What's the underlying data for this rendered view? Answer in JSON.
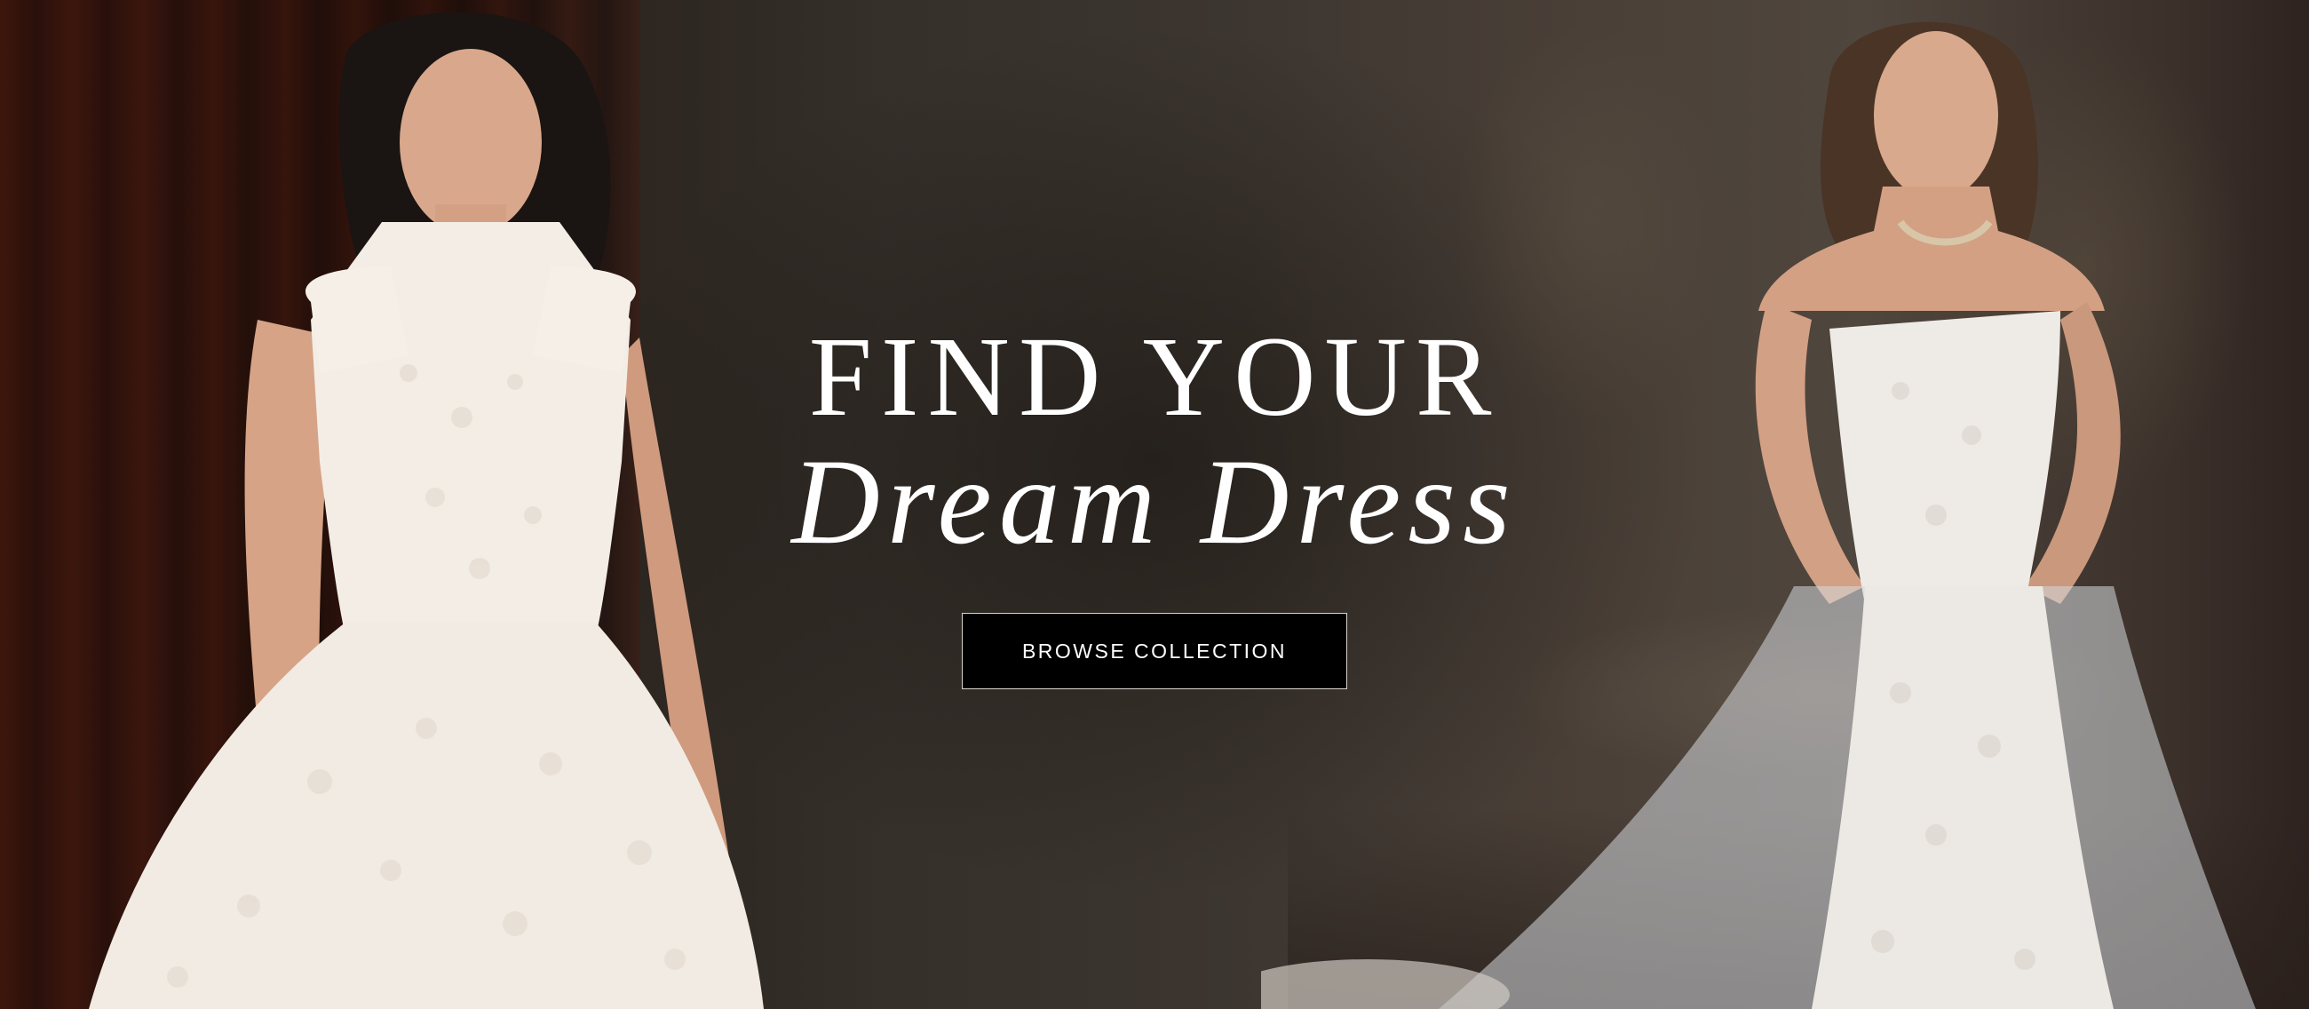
{
  "hero": {
    "headline_line1": "FIND YOUR",
    "headline_line2": "Dream Dress",
    "cta_label": "BROWSE COLLECTION"
  },
  "colors": {
    "text": "#ffffff",
    "cta_background": "#000000",
    "cta_border": "#d9d3cd",
    "background_dark": "#2a211c"
  },
  "images": {
    "left_model": "bride-in-lace-high-neck-ballgown",
    "right_model": "bride-in-strapless-lace-mermaid-gown-with-overskirt"
  }
}
